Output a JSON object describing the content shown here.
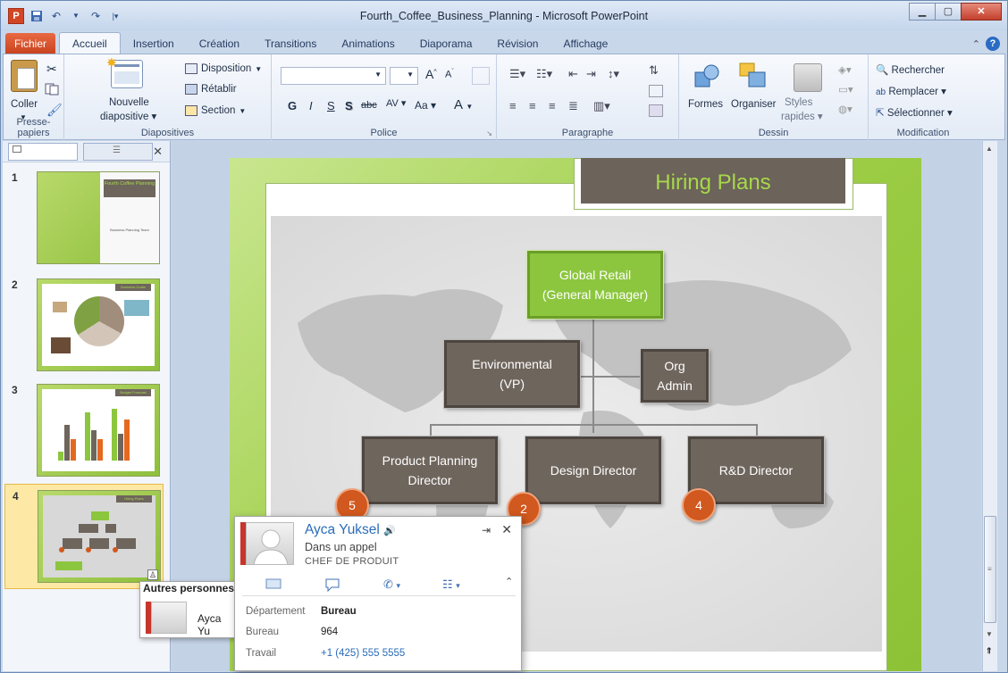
{
  "window": {
    "title": "Fourth_Coffee_Business_Planning - Microsoft PowerPoint",
    "app_icon": "P",
    "buttons": {
      "minimize": "minimize-icon",
      "maximize": "maximize-icon",
      "close": "close-icon"
    }
  },
  "quick_access": [
    "save-icon",
    "undo-icon",
    "redo-icon",
    "customize-icon"
  ],
  "tabs": [
    "Fichier",
    "Accueil",
    "Insertion",
    "Création",
    "Transitions",
    "Animations",
    "Diaporama",
    "Révision",
    "Affichage"
  ],
  "active_tab": "Accueil",
  "ribbon": {
    "clipboard": {
      "paste": "Coller",
      "group": "Presse-papiers"
    },
    "slides": {
      "new_slide_1": "Nouvelle",
      "new_slide_2": "diapositive",
      "layout": "Disposition",
      "reset": "Rétablir",
      "section": "Section",
      "group": "Diapositives"
    },
    "font": {
      "bold": "G",
      "italic": "I",
      "underline": "S",
      "shadow": "S",
      "strike": "abc",
      "spacing": "AV",
      "case": "Aa",
      "color": "A",
      "group": "Police"
    },
    "paragraph": {
      "group": "Paragraphe"
    },
    "drawing": {
      "shapes": "Formes",
      "arrange": "Organiser",
      "styles_1": "Styles",
      "styles_2": "rapides",
      "group": "Dessin"
    },
    "editing": {
      "find": "Rechercher",
      "replace": "Remplacer",
      "select": "Sélectionner",
      "group": "Modification"
    }
  },
  "thumbnails": [
    {
      "num": "1",
      "title": "Fourth Coffee Planning",
      "sub": "Business Planning Team"
    },
    {
      "num": "2",
      "title": "Business Goals"
    },
    {
      "num": "3",
      "title": "Budget Forecast"
    },
    {
      "num": "4",
      "title": "Hiring Plans",
      "selected": true
    }
  ],
  "slide": {
    "title": "Hiring Plans",
    "org": {
      "top_1": "Global Retail",
      "top_2": "(General Manager)",
      "vp_1": "Environmental",
      "vp_2": "(VP)",
      "admin_1": "Org",
      "admin_2": "Admin",
      "d1_1": "Product Planning",
      "d1_2": "Director",
      "d2": "Design Director",
      "d3": "R&D Director"
    },
    "badges": [
      "5",
      "2",
      "4"
    ]
  },
  "contact_card": {
    "name": "Ayca Yuksel",
    "status": "Dans un appel",
    "role": "CHEF DE PRODUIT",
    "dept_label": "Département",
    "dept_value": "Bureau",
    "office_label": "Bureau",
    "office_value": "964",
    "work_label": "Travail",
    "work_value": "+1 (425) 555 5555"
  },
  "other_people": {
    "title": "Autres personnes",
    "name": "Ayca Yu"
  },
  "colors": {
    "accent_green": "#8cc63e",
    "box_brown": "#6e655d",
    "badge_orange": "#d1581e",
    "file_tab": "#c8421e"
  }
}
